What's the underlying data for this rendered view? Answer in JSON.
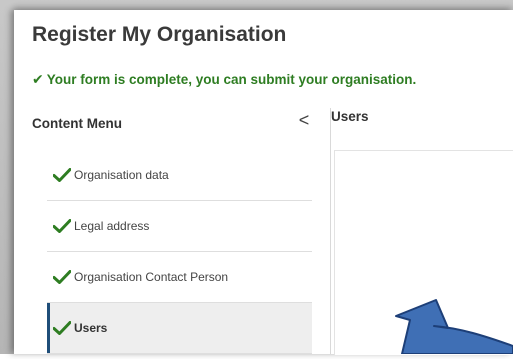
{
  "page": {
    "title": "Register My Organisation",
    "status_message": "Your form is complete, you can submit your organisation."
  },
  "menu": {
    "header": "Content Menu",
    "collapse_glyph": "<",
    "items": [
      {
        "label": "Organisation data",
        "icon": "check-icon",
        "active": false
      },
      {
        "label": "Legal address",
        "icon": "check-icon",
        "active": false
      },
      {
        "label": "Organisation Contact Person",
        "icon": "check-icon",
        "active": false
      },
      {
        "label": "Users",
        "icon": "check-icon",
        "active": true
      }
    ]
  },
  "content": {
    "header": "Users"
  },
  "colors": {
    "success": "#2e7d22",
    "active_bar": "#1f4e79",
    "arrow_fill": "#3f6fb5"
  }
}
